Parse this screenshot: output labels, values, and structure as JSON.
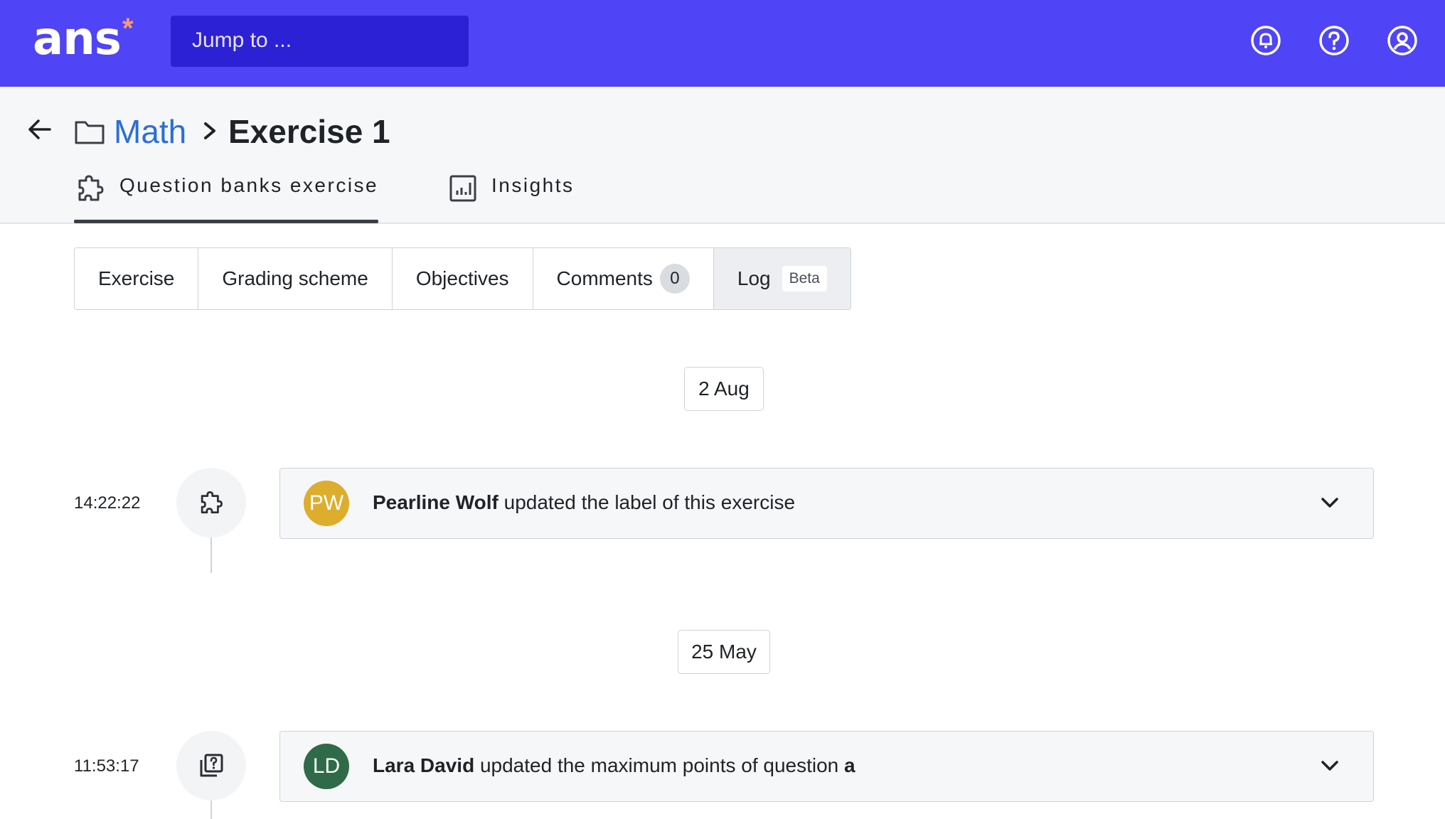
{
  "topbar": {
    "logo": "ans",
    "logo_mark": "*",
    "jump_placeholder": "Jump to ...",
    "icons": [
      "bell-icon",
      "help-icon",
      "account-icon"
    ]
  },
  "breadcrumb": {
    "folder": "Math",
    "separator": ">",
    "current": "Exercise 1"
  },
  "tabs": [
    {
      "label": "Question banks exercise",
      "icon": "puzzle-icon",
      "active": true
    },
    {
      "label": "Insights",
      "icon": "chart-icon",
      "active": false
    }
  ],
  "subtabs": {
    "exercise": "Exercise",
    "grading": "Grading scheme",
    "objectives": "Objectives",
    "comments": "Comments",
    "comments_count": "0",
    "log": "Log",
    "log_badge": "Beta"
  },
  "log": [
    {
      "date": "2 Aug",
      "time": "14:22:22",
      "icon": "puzzle-icon",
      "initials": "PW",
      "avatar_color": "#ddad2e",
      "user": "Pearline Wolf",
      "action": " updated the label of this exercise",
      "target": ""
    },
    {
      "date": "25 May",
      "time": "11:53:17",
      "icon": "question-bank-icon",
      "initials": "LD",
      "avatar_color": "#2f6b48",
      "user": "Lara David",
      "action": " updated the maximum points of question ",
      "target": "a"
    }
  ],
  "colors": {
    "brand": "#4f44f6",
    "jump_bg": "#2d21d6",
    "link": "#2b6fd6"
  }
}
